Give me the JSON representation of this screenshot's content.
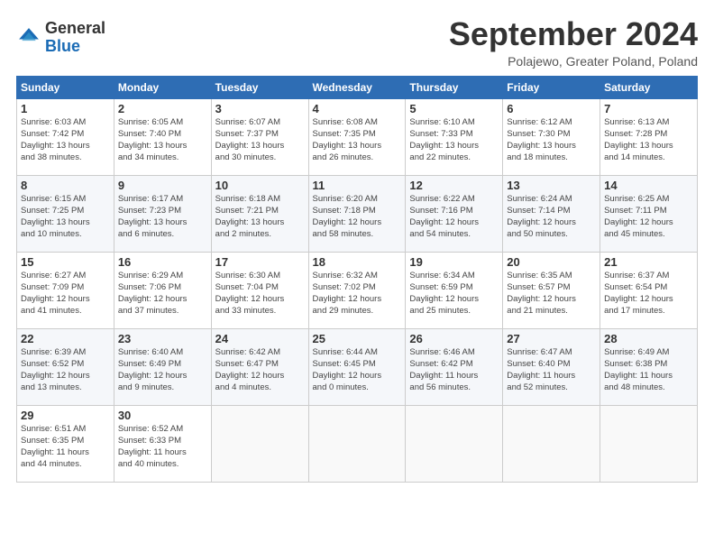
{
  "header": {
    "logo_line1": "General",
    "logo_line2": "Blue",
    "month": "September 2024",
    "location": "Polajewo, Greater Poland, Poland"
  },
  "weekdays": [
    "Sunday",
    "Monday",
    "Tuesday",
    "Wednesday",
    "Thursday",
    "Friday",
    "Saturday"
  ],
  "weeks": [
    [
      {
        "day": "1",
        "rise": "6:03 AM",
        "set": "7:42 PM",
        "hours": "13 hours",
        "mins": "38 minutes"
      },
      {
        "day": "2",
        "rise": "6:05 AM",
        "set": "7:40 PM",
        "hours": "13 hours",
        "mins": "34 minutes"
      },
      {
        "day": "3",
        "rise": "6:07 AM",
        "set": "7:37 PM",
        "hours": "13 hours",
        "mins": "30 minutes"
      },
      {
        "day": "4",
        "rise": "6:08 AM",
        "set": "7:35 PM",
        "hours": "13 hours",
        "mins": "26 minutes"
      },
      {
        "day": "5",
        "rise": "6:10 AM",
        "set": "7:33 PM",
        "hours": "13 hours",
        "mins": "22 minutes"
      },
      {
        "day": "6",
        "rise": "6:12 AM",
        "set": "7:30 PM",
        "hours": "13 hours",
        "mins": "18 minutes"
      },
      {
        "day": "7",
        "rise": "6:13 AM",
        "set": "7:28 PM",
        "hours": "13 hours",
        "mins": "14 minutes"
      }
    ],
    [
      {
        "day": "8",
        "rise": "6:15 AM",
        "set": "7:25 PM",
        "hours": "13 hours",
        "mins": "10 minutes"
      },
      {
        "day": "9",
        "rise": "6:17 AM",
        "set": "7:23 PM",
        "hours": "13 hours",
        "mins": "6 minutes"
      },
      {
        "day": "10",
        "rise": "6:18 AM",
        "set": "7:21 PM",
        "hours": "13 hours",
        "mins": "2 minutes"
      },
      {
        "day": "11",
        "rise": "6:20 AM",
        "set": "7:18 PM",
        "hours": "12 hours",
        "mins": "58 minutes"
      },
      {
        "day": "12",
        "rise": "6:22 AM",
        "set": "7:16 PM",
        "hours": "12 hours",
        "mins": "54 minutes"
      },
      {
        "day": "13",
        "rise": "6:24 AM",
        "set": "7:14 PM",
        "hours": "12 hours",
        "mins": "50 minutes"
      },
      {
        "day": "14",
        "rise": "6:25 AM",
        "set": "7:11 PM",
        "hours": "12 hours",
        "mins": "45 minutes"
      }
    ],
    [
      {
        "day": "15",
        "rise": "6:27 AM",
        "set": "7:09 PM",
        "hours": "12 hours",
        "mins": "41 minutes"
      },
      {
        "day": "16",
        "rise": "6:29 AM",
        "set": "7:06 PM",
        "hours": "12 hours",
        "mins": "37 minutes"
      },
      {
        "day": "17",
        "rise": "6:30 AM",
        "set": "7:04 PM",
        "hours": "12 hours",
        "mins": "33 minutes"
      },
      {
        "day": "18",
        "rise": "6:32 AM",
        "set": "7:02 PM",
        "hours": "12 hours",
        "mins": "29 minutes"
      },
      {
        "day": "19",
        "rise": "6:34 AM",
        "set": "6:59 PM",
        "hours": "12 hours",
        "mins": "25 minutes"
      },
      {
        "day": "20",
        "rise": "6:35 AM",
        "set": "6:57 PM",
        "hours": "12 hours",
        "mins": "21 minutes"
      },
      {
        "day": "21",
        "rise": "6:37 AM",
        "set": "6:54 PM",
        "hours": "12 hours",
        "mins": "17 minutes"
      }
    ],
    [
      {
        "day": "22",
        "rise": "6:39 AM",
        "set": "6:52 PM",
        "hours": "12 hours",
        "mins": "13 minutes"
      },
      {
        "day": "23",
        "rise": "6:40 AM",
        "set": "6:49 PM",
        "hours": "12 hours",
        "mins": "9 minutes"
      },
      {
        "day": "24",
        "rise": "6:42 AM",
        "set": "6:47 PM",
        "hours": "12 hours",
        "mins": "4 minutes"
      },
      {
        "day": "25",
        "rise": "6:44 AM",
        "set": "6:45 PM",
        "hours": "12 hours",
        "mins": "0 minutes"
      },
      {
        "day": "26",
        "rise": "6:46 AM",
        "set": "6:42 PM",
        "hours": "11 hours",
        "mins": "56 minutes"
      },
      {
        "day": "27",
        "rise": "6:47 AM",
        "set": "6:40 PM",
        "hours": "11 hours",
        "mins": "52 minutes"
      },
      {
        "day": "28",
        "rise": "6:49 AM",
        "set": "6:38 PM",
        "hours": "11 hours",
        "mins": "48 minutes"
      }
    ],
    [
      {
        "day": "29",
        "rise": "6:51 AM",
        "set": "6:35 PM",
        "hours": "11 hours",
        "mins": "44 minutes"
      },
      {
        "day": "30",
        "rise": "6:52 AM",
        "set": "6:33 PM",
        "hours": "11 hours",
        "mins": "40 minutes"
      },
      null,
      null,
      null,
      null,
      null
    ]
  ]
}
